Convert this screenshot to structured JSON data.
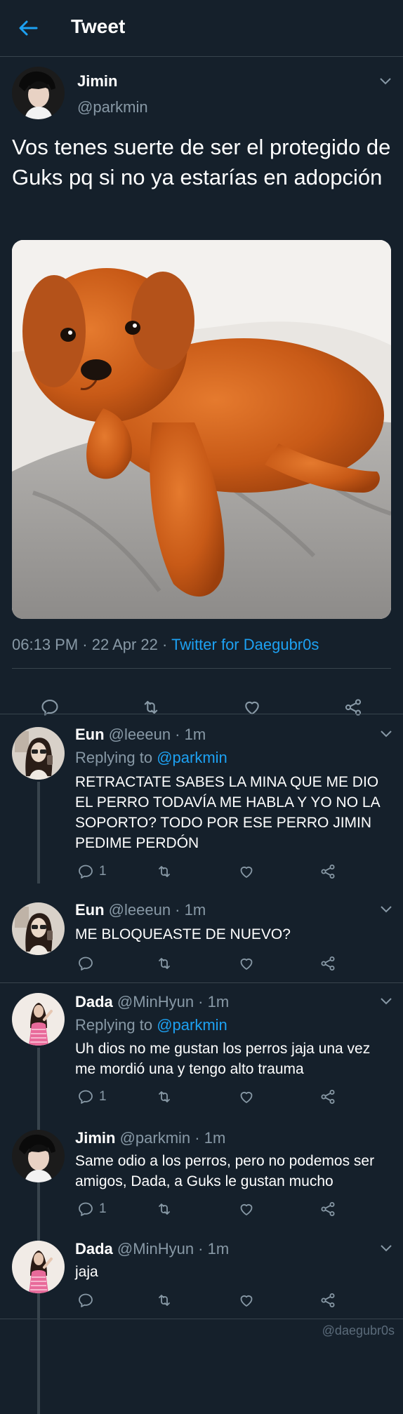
{
  "header": {
    "title": "Tweet"
  },
  "tweet": {
    "name": "Jimin",
    "handle": "@parkmin",
    "text": "Vos tenes suerte de ser el protegido de Guks pq si no ya estarías en adopción",
    "time": "06:13 PM · 22 Apr 22 · ",
    "source": "Twitter for Daegubr0s"
  },
  "replies": [
    {
      "name": "Eun",
      "meta": " @leeeun · 1m",
      "replying_prefix": "Replying to ",
      "replying_to": "@parkmin",
      "text": "RETRACTATE SABES LA MINA QUE ME DIO EL PERRO TODAVÍA ME HABLA Y YO NO LA SOPORTO? TODO POR ESE PERRO JIMIN PEDIME PERDÓN",
      "reply_count": "1"
    },
    {
      "name": "Eun",
      "meta": " @leeeun · 1m",
      "text": "ME BLOQUEASTE DE NUEVO?"
    },
    {
      "name": "Dada",
      "meta": " @MinHyun · 1m",
      "replying_prefix": "Replying to ",
      "replying_to": "@parkmin",
      "text": "Uh dios no me gustan los perros jaja una vez me mordió una y tengo alto trauma",
      "reply_count": "1"
    },
    {
      "name": "Jimin",
      "meta": " @parkmin · 1m",
      "text": "Same odio a los perros, pero no podemos ser amigos, Dada, a Guks le gustan mucho",
      "reply_count": "1"
    },
    {
      "name": "Dada",
      "meta": " @MinHyun · 1m",
      "text": "jaja"
    }
  ],
  "watermark": "@daegubr0s",
  "colors": {
    "background": "#15202b",
    "accent": "#1da1f2",
    "muted": "#8899a6",
    "divider": "#38444d"
  }
}
